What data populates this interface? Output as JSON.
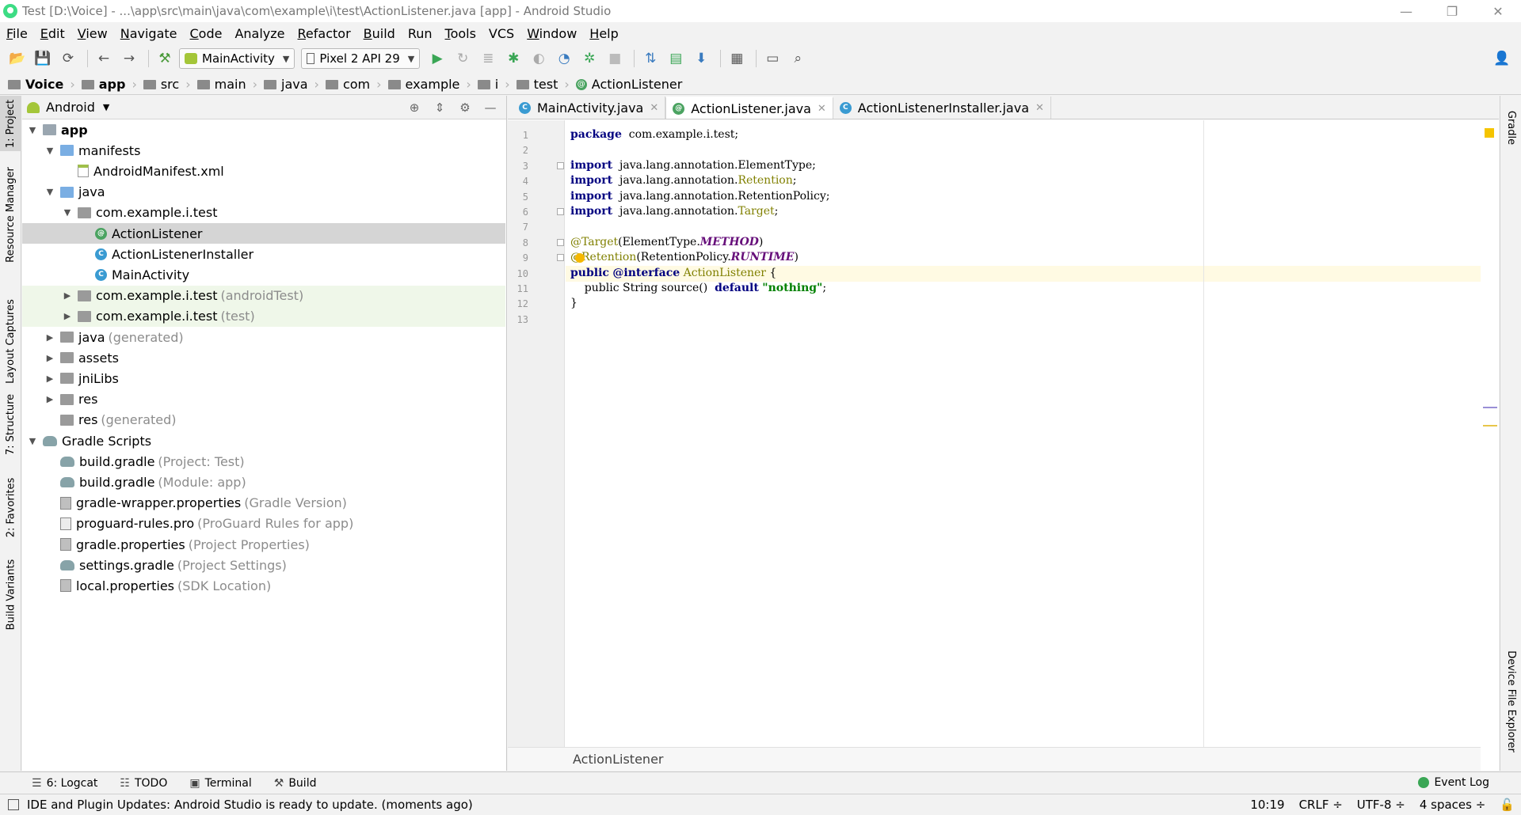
{
  "window": {
    "title": "Test [D:\\Voice] - ...\\app\\src\\main\\java\\com\\example\\i\\test\\ActionListener.java [app] - Android Studio",
    "controls": [
      "—",
      "❐",
      "✕"
    ]
  },
  "menu": [
    {
      "u": "F",
      "rest": "ile"
    },
    {
      "u": "E",
      "rest": "dit"
    },
    {
      "u": "V",
      "rest": "iew"
    },
    {
      "u": "N",
      "rest": "avigate"
    },
    {
      "u": "C",
      "rest": "ode"
    },
    {
      "u": "",
      "rest": "Analyze"
    },
    {
      "u": "R",
      "rest": "efactor"
    },
    {
      "u": "B",
      "rest": "uild"
    },
    {
      "u": "",
      "rest": "Run"
    },
    {
      "u": "T",
      "rest": "ools"
    },
    {
      "u": "",
      "rest": "VCS"
    },
    {
      "u": "W",
      "rest": "indow"
    },
    {
      "u": "H",
      "rest": "elp"
    }
  ],
  "toolbar": {
    "run_config": "MainActivity",
    "device": "Pixel 2 API 29"
  },
  "breadcrumb": [
    "Voice",
    "app",
    "src",
    "main",
    "java",
    "com",
    "example",
    "i",
    "test",
    "ActionListener"
  ],
  "left_strip": [
    "1: Project",
    "Resource Manager",
    "Layout Captures",
    "7: Structure",
    "2: Favorites",
    "Build Variants"
  ],
  "right_strip": [
    "Gradle",
    "Device File Explorer"
  ],
  "project": {
    "view": "Android",
    "tree": [
      {
        "indent": 0,
        "tog": "▼",
        "icon": "folder-app",
        "label": "app",
        "bold": true
      },
      {
        "indent": 1,
        "tog": "▼",
        "icon": "folder-blue",
        "label": "manifests"
      },
      {
        "indent": 2,
        "tog": "",
        "icon": "file-xml",
        "label": "AndroidManifest.xml"
      },
      {
        "indent": 1,
        "tog": "▼",
        "icon": "folder-blue",
        "label": "java"
      },
      {
        "indent": 2,
        "tog": "▼",
        "icon": "folder-gray",
        "label": "com.example.i.test"
      },
      {
        "indent": 3,
        "tog": "",
        "icon": "c-anno",
        "glyph": "@",
        "label": "ActionListener",
        "selected": true
      },
      {
        "indent": 3,
        "tog": "",
        "icon": "c-class",
        "glyph": "C",
        "label": "ActionListenerInstaller"
      },
      {
        "indent": 3,
        "tog": "",
        "icon": "c-class",
        "glyph": "C",
        "label": "MainActivity"
      },
      {
        "indent": 2,
        "tog": "▶",
        "icon": "folder-gray",
        "label": "com.example.i.test",
        "suffix": "(androidTest)",
        "green": true
      },
      {
        "indent": 2,
        "tog": "▶",
        "icon": "folder-gray",
        "label": "com.example.i.test",
        "suffix": "(test)",
        "green": true
      },
      {
        "indent": 1,
        "tog": "▶",
        "icon": "folder-gray",
        "label": "java",
        "suffix": "(generated)"
      },
      {
        "indent": 1,
        "tog": "▶",
        "icon": "folder-gray",
        "label": "assets"
      },
      {
        "indent": 1,
        "tog": "▶",
        "icon": "folder-gray",
        "label": "jniLibs"
      },
      {
        "indent": 1,
        "tog": "▶",
        "icon": "folder-gray",
        "label": "res"
      },
      {
        "indent": 1,
        "tog": "",
        "icon": "folder-gray",
        "label": "res",
        "suffix": "(generated)"
      },
      {
        "indent": 0,
        "tog": "▼",
        "icon": "gradle",
        "label": "Gradle Scripts"
      },
      {
        "indent": 1,
        "tog": "",
        "icon": "gradle",
        "label": "build.gradle",
        "suffix": "(Project: Test)"
      },
      {
        "indent": 1,
        "tog": "",
        "icon": "gradle",
        "label": "build.gradle",
        "suffix": "(Module: app)"
      },
      {
        "indent": 1,
        "tog": "",
        "icon": "props",
        "label": "gradle-wrapper.properties",
        "suffix": "(Gradle Version)"
      },
      {
        "indent": 1,
        "tog": "",
        "icon": "pro",
        "label": "proguard-rules.pro",
        "suffix": "(ProGuard Rules for app)"
      },
      {
        "indent": 1,
        "tog": "",
        "icon": "props",
        "label": "gradle.properties",
        "suffix": "(Project Properties)"
      },
      {
        "indent": 1,
        "tog": "",
        "icon": "gradle",
        "label": "settings.gradle",
        "suffix": "(Project Settings)"
      },
      {
        "indent": 1,
        "tog": "",
        "icon": "props",
        "label": "local.properties",
        "suffix": "(SDK Location)"
      }
    ]
  },
  "editor": {
    "tabs": [
      {
        "label": "MainActivity.java",
        "glyph": "C",
        "color": "#3a9bd2",
        "active": false
      },
      {
        "label": "ActionListener.java",
        "glyph": "@",
        "color": "#4ba361",
        "active": true
      },
      {
        "label": "ActionListenerInstaller.java",
        "glyph": "C",
        "color": "#3a9bd2",
        "active": false
      }
    ],
    "current_line": 10,
    "lines": [
      [
        [
          "kw",
          "package"
        ],
        [
          "",
          "  com.example.i.test;"
        ]
      ],
      [],
      [
        [
          "kw",
          "import"
        ],
        [
          "",
          "  java.lang.annotation.ElementType;"
        ]
      ],
      [
        [
          "kw",
          "import"
        ],
        [
          "",
          "  java.lang.annotation."
        ],
        [
          "ty",
          "Retention"
        ],
        [
          "",
          ";"
        ]
      ],
      [
        [
          "kw",
          "import"
        ],
        [
          "",
          "  java.lang.annotation.RetentionPolicy;"
        ]
      ],
      [
        [
          "kw",
          "import"
        ],
        [
          "",
          "  java.lang.annotation."
        ],
        [
          "ty",
          "Target"
        ],
        [
          "",
          ";"
        ]
      ],
      [],
      [
        [
          "an",
          "@Target"
        ],
        [
          "",
          "(ElementType."
        ],
        [
          "cn",
          "METHOD"
        ],
        [
          "",
          ")"
        ]
      ],
      [
        [
          "an",
          "@Retention"
        ],
        [
          "",
          "(RetentionPolicy."
        ],
        [
          "cn",
          "RUNTIME"
        ],
        [
          "",
          ")"
        ]
      ],
      [
        [
          "kw",
          "public"
        ],
        [
          "",
          " "
        ],
        [
          "kw",
          "@interface"
        ],
        [
          "",
          " "
        ],
        [
          "ty",
          "ActionListener"
        ],
        [
          "",
          " {"
        ]
      ],
      [
        [
          "",
          "    public String source()  "
        ],
        [
          "kw",
          "default"
        ],
        [
          "",
          " "
        ],
        [
          "st",
          "\"nothing\""
        ],
        [
          "",
          ";"
        ]
      ],
      [
        [
          "",
          "}"
        ]
      ],
      []
    ],
    "status": "ActionListener"
  },
  "bottom_tabs": [
    {
      "icon": "☰",
      "label": "6: Logcat"
    },
    {
      "icon": "☷",
      "label": "TODO"
    },
    {
      "icon": "▣",
      "label": "Terminal"
    },
    {
      "icon": "⚒",
      "label": "Build"
    }
  ],
  "event_log": "Event Log",
  "status_bar": {
    "message": "IDE and Plugin Updates: Android Studio is ready to update. (moments ago)",
    "position": "10:19",
    "line_sep": "CRLF ÷",
    "encoding": "UTF-8 ÷",
    "indent": "4 spaces ÷"
  },
  "colors": {
    "keyword": "#000080",
    "annotation": "#808000",
    "constant": "#660e7a",
    "string": "#008000",
    "selection": "#d5d5d5",
    "current_line": "#fffae3"
  }
}
